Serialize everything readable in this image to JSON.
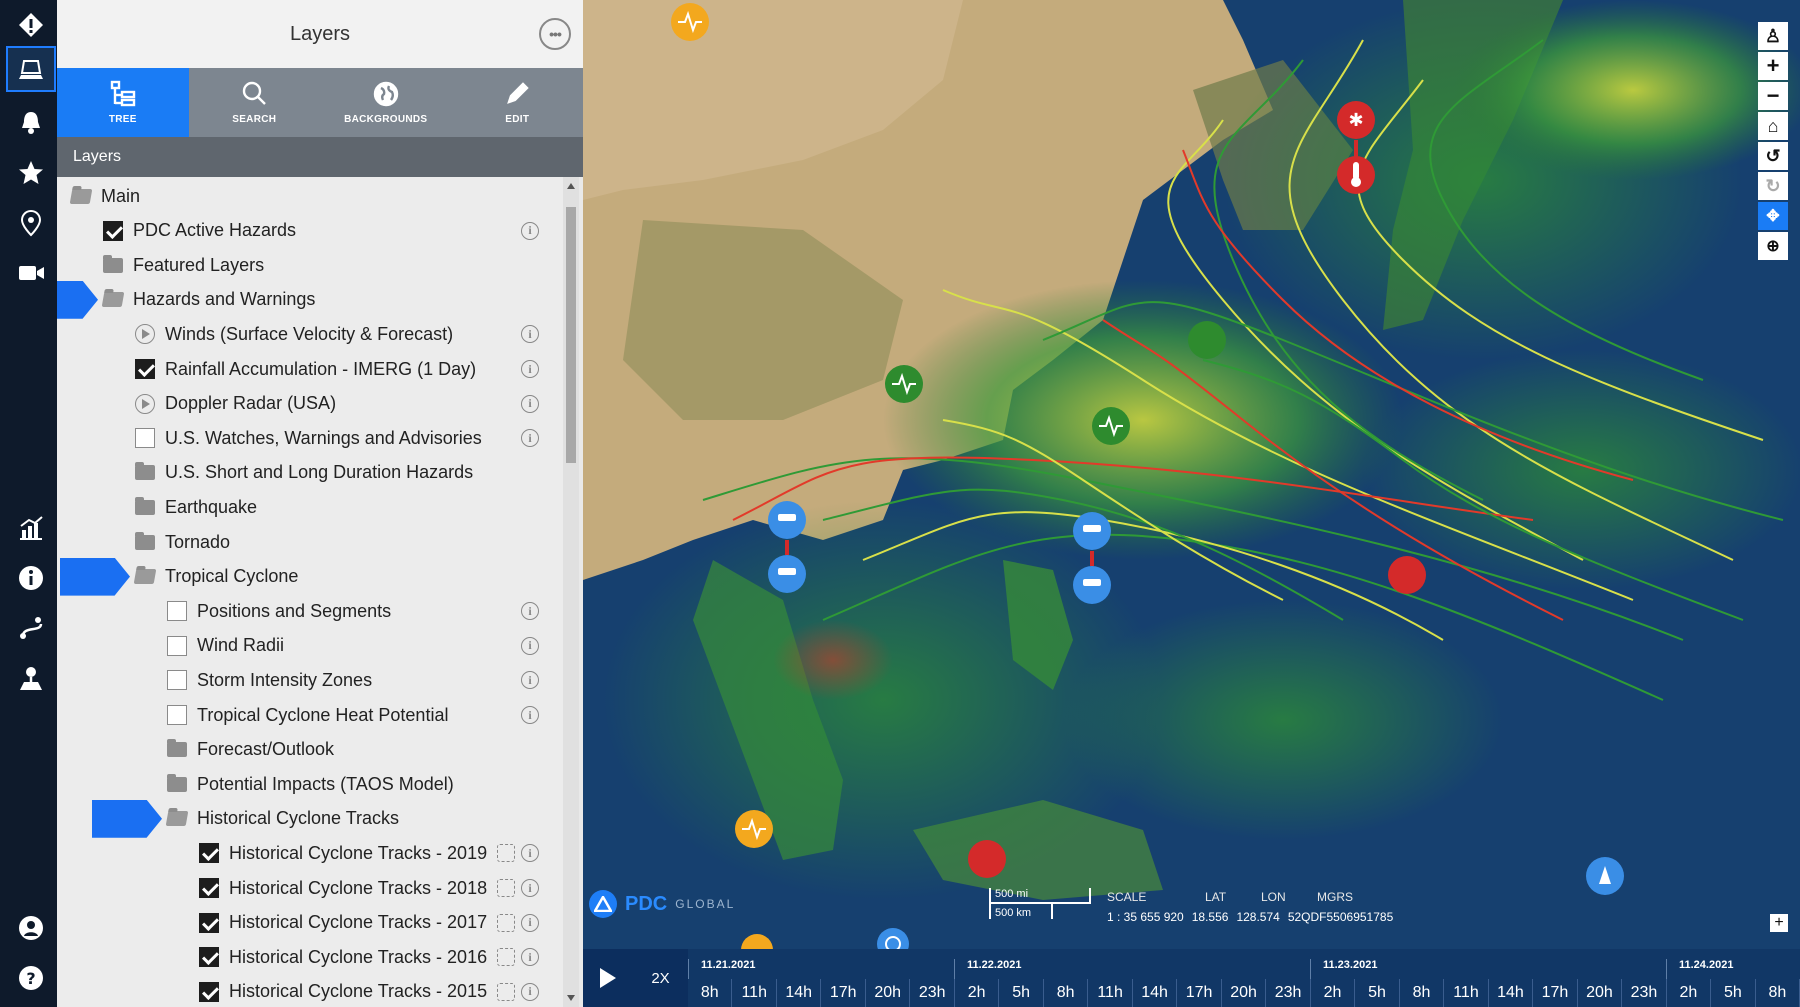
{
  "panel": {
    "title": "Layers",
    "more_label": "•••",
    "tabs": [
      {
        "label": "TREE",
        "icon": "tree-icon",
        "active": true
      },
      {
        "label": "SEARCH",
        "icon": "search-icon",
        "active": false
      },
      {
        "label": "BACKGROUNDS",
        "icon": "globe-icon",
        "active": false
      },
      {
        "label": "EDIT",
        "icon": "pencil-icon",
        "active": false
      }
    ],
    "subheader": "Layers",
    "tree": [
      {
        "label": "Main",
        "type": "folder-open",
        "level": 0
      },
      {
        "label": "PDC Active Hazards",
        "type": "checkbox",
        "checked": true,
        "level": 1,
        "info": true
      },
      {
        "label": "Featured Layers",
        "type": "folder",
        "level": 1
      },
      {
        "label": "Hazards and Warnings",
        "type": "folder-open",
        "level": 1,
        "highlighted": true
      },
      {
        "label": "Winds (Surface Velocity & Forecast)",
        "type": "play",
        "level": 2,
        "info": true
      },
      {
        "label": "Rainfall Accumulation - IMERG (1 Day)",
        "type": "checkbox",
        "checked": true,
        "level": 2,
        "info": true
      },
      {
        "label": "Doppler Radar (USA)",
        "type": "play",
        "level": 2,
        "info": true
      },
      {
        "label": "U.S. Watches, Warnings and Advisories",
        "type": "checkbox",
        "checked": false,
        "level": 2,
        "info": true
      },
      {
        "label": "U.S. Short and Long Duration Hazards",
        "type": "folder",
        "level": 2
      },
      {
        "label": "Earthquake",
        "type": "folder",
        "level": 2
      },
      {
        "label": "Tornado",
        "type": "folder",
        "level": 2
      },
      {
        "label": "Tropical Cyclone",
        "type": "folder-open",
        "level": 2,
        "highlighted": true
      },
      {
        "label": "Positions and Segments",
        "type": "checkbox",
        "checked": false,
        "level": 3,
        "info": true
      },
      {
        "label": "Wind Radii",
        "type": "checkbox",
        "checked": false,
        "level": 3,
        "info": true
      },
      {
        "label": "Storm Intensity Zones",
        "type": "checkbox",
        "checked": false,
        "level": 3,
        "info": true
      },
      {
        "label": "Tropical Cyclone Heat Potential",
        "type": "checkbox",
        "checked": false,
        "level": 3,
        "info": true
      },
      {
        "label": "Forecast/Outlook",
        "type": "folder",
        "level": 3
      },
      {
        "label": "Potential Impacts (TAOS Model)",
        "type": "folder",
        "level": 3
      },
      {
        "label": "Historical Cyclone Tracks",
        "type": "folder-open",
        "level": 3,
        "highlighted": true
      },
      {
        "label": "Historical Cyclone Tracks - 2019",
        "type": "checkbox",
        "checked": true,
        "level": 4,
        "info": true,
        "zoom": true
      },
      {
        "label": "Historical Cyclone Tracks - 2018",
        "type": "checkbox",
        "checked": true,
        "level": 4,
        "info": true,
        "zoom": true
      },
      {
        "label": "Historical Cyclone Tracks - 2017",
        "type": "checkbox",
        "checked": true,
        "level": 4,
        "info": true,
        "zoom": true
      },
      {
        "label": "Historical Cyclone Tracks - 2016",
        "type": "checkbox",
        "checked": true,
        "level": 4,
        "info": true,
        "zoom": true
      },
      {
        "label": "Historical Cyclone Tracks - 2015",
        "type": "checkbox",
        "checked": true,
        "level": 4,
        "info": true,
        "zoom": true
      }
    ]
  },
  "rail": [
    {
      "name": "hazard-alert-icon",
      "active": false
    },
    {
      "name": "layers-icon",
      "active": true
    },
    {
      "name": "bell-icon",
      "active": false
    },
    {
      "name": "star-icon",
      "active": false
    },
    {
      "name": "location-pin-icon",
      "active": false
    },
    {
      "name": "video-camera-icon",
      "active": false
    },
    {
      "name": "chart-icon",
      "active": false
    },
    {
      "name": "info-icon",
      "active": false
    },
    {
      "name": "route-icon",
      "active": false
    },
    {
      "name": "map-pin-icon",
      "active": false
    },
    {
      "name": "user-icon",
      "active": false
    },
    {
      "name": "help-icon",
      "active": false
    }
  ],
  "map": {
    "logo_text": "PDC",
    "logo_sub": "GLOBAL",
    "scale_mi": "500 mi",
    "scale_km": "500 km",
    "labels": {
      "scale": "SCALE",
      "lat": "LAT",
      "lon": "LON",
      "mgrs": "MGRS"
    },
    "values": {
      "scale": "1 : 35 655 920",
      "lat": "18.556",
      "lon": "128.574",
      "mgrs": "52QDF5506951785"
    },
    "controls": [
      "pegman-icon",
      "zoom-in-icon",
      "zoom-out-icon",
      "home-icon",
      "rotate-left-icon",
      "rotate-right-icon",
      "pan-icon",
      "zoom-box-icon"
    ],
    "colors": {
      "ocean": "#17406e",
      "land": "#c4ab7c",
      "rain_green": "#2f8a3a",
      "track_yellow": "#d8e04a",
      "track_red": "#e23a2a"
    }
  },
  "timeline": {
    "speed": "2X",
    "dates": [
      "11.21.2021",
      "11.22.2021",
      "11.23.2021",
      "11.24.2021"
    ],
    "hours": [
      "8h",
      "11h",
      "14h",
      "17h",
      "20h",
      "23h",
      "2h",
      "5h",
      "8h",
      "11h",
      "14h",
      "17h",
      "20h",
      "23h",
      "2h",
      "5h",
      "8h",
      "11h",
      "14h",
      "17h",
      "20h",
      "23h",
      "2h",
      "5h",
      "8h"
    ]
  }
}
